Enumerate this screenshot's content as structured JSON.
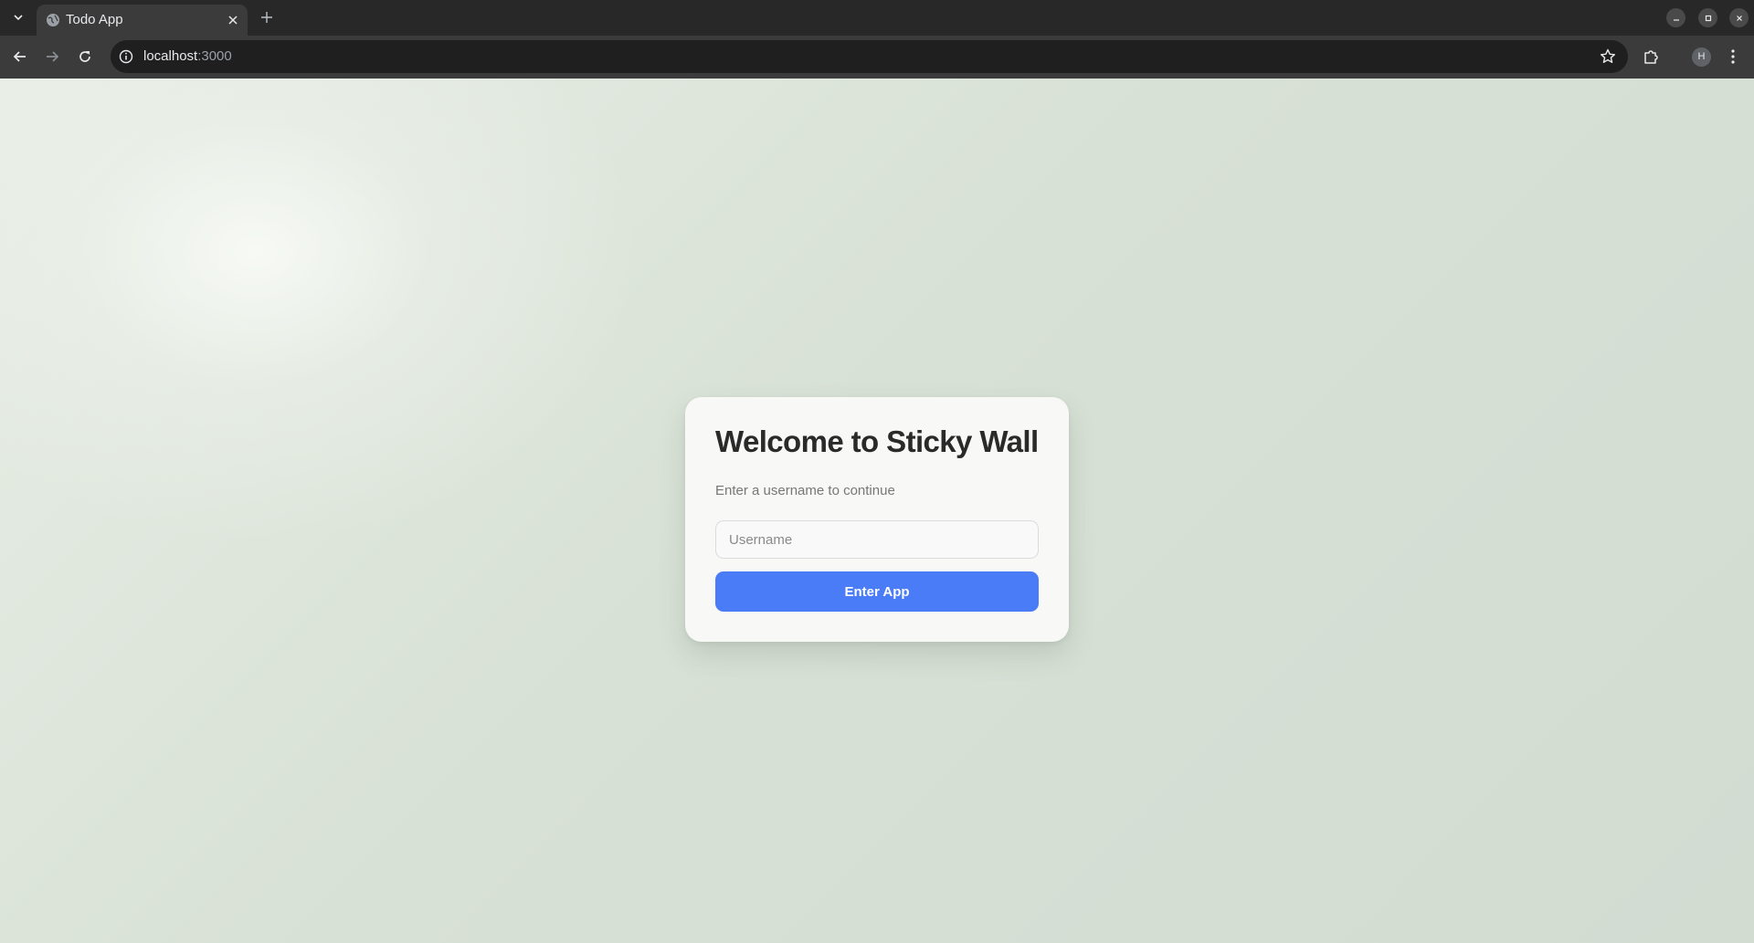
{
  "browser": {
    "tab": {
      "title": "Todo App",
      "favicon": "globe-icon"
    },
    "new_tab_icon": "plus-icon",
    "address": {
      "host": "localhost",
      "port": ":3000"
    },
    "profile_initial": "H",
    "window_controls": [
      "minimize-icon",
      "maximize-icon",
      "close-icon"
    ]
  },
  "page": {
    "title": "Welcome to Sticky Wall",
    "subtitle": "Enter a username to continue",
    "username": {
      "value": "",
      "placeholder": "Username"
    },
    "submit_label": "Enter App"
  },
  "colors": {
    "accent": "#4a7cf7",
    "background": "#d6dfd4",
    "card": "#f8f8f7"
  }
}
